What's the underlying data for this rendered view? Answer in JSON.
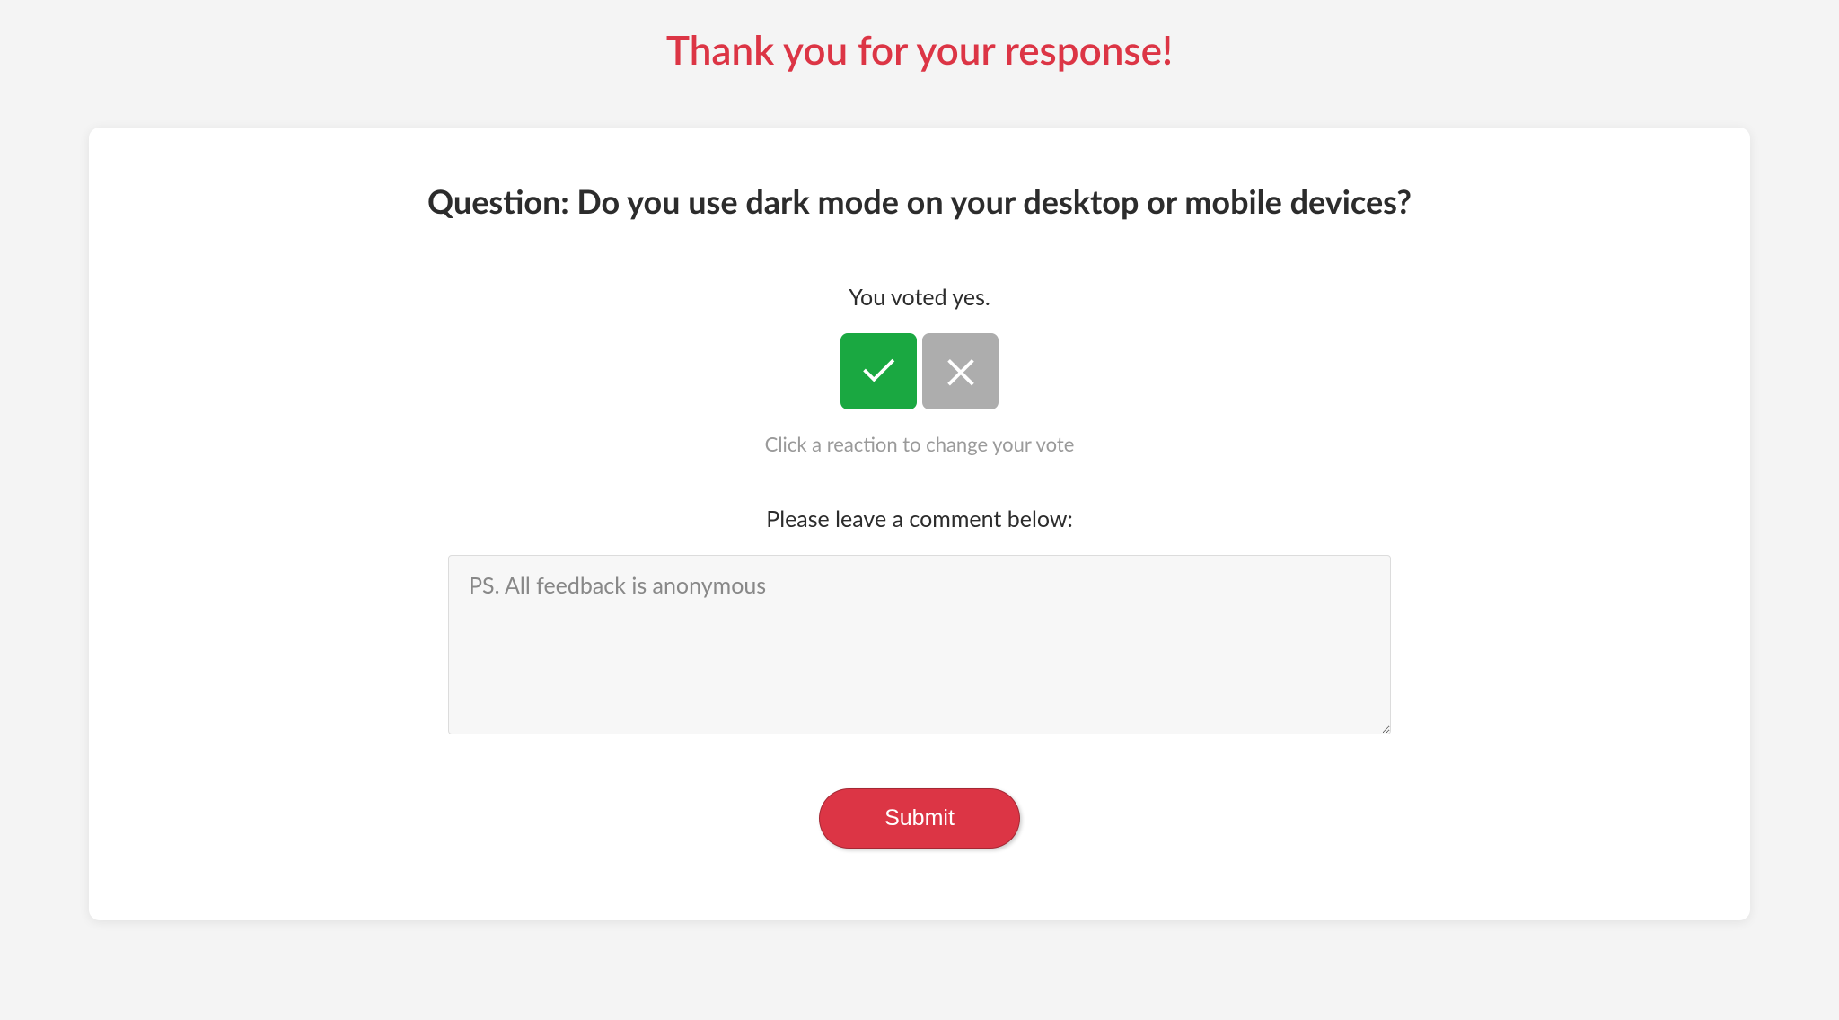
{
  "header": {
    "title": "Thank you for your response!"
  },
  "card": {
    "question": "Question: Do you use dark mode on your desktop or mobile devices?",
    "voted_text": "You voted yes.",
    "hint": "Click a reaction to change your vote",
    "comment_label": "Please leave a comment below:",
    "comment_placeholder": "PS. All feedback is anonymous",
    "submit_label": "Submit"
  },
  "reactions": {
    "yes_selected": true,
    "no_selected": false
  },
  "colors": {
    "accent": "#dc3545",
    "yes": "#1aa841",
    "no_inactive": "#adadad"
  }
}
